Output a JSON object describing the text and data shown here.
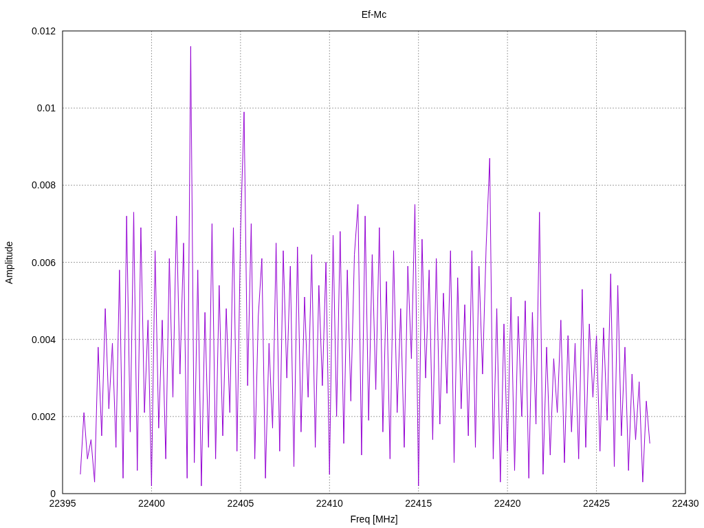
{
  "plot": {
    "chart_data": {
      "type": "line",
      "grid": true,
      "title": "Ef-Mc",
      "xlabel": "Freq [MHz]",
      "ylabel": "Amplitude",
      "xlim": [
        22395,
        22430
      ],
      "ylim": [
        0,
        0.012
      ],
      "xticks": [
        22395,
        22400,
        22405,
        22410,
        22415,
        22420,
        22425,
        22430
      ],
      "yticks": [
        0.012,
        0.01,
        0.008,
        0.006,
        0.004,
        0.002,
        0
      ],
      "x": [
        22396,
        22396.2,
        22396.4,
        22396.6,
        22396.8,
        22397,
        22397.2,
        22397.4,
        22397.6,
        22397.8,
        22398,
        22398.2,
        22398.4,
        22398.6,
        22398.8,
        22399,
        22399.2,
        22399.4,
        22399.6,
        22399.8,
        22400,
        22400.2,
        22400.4,
        22400.6,
        22400.8,
        22401,
        22401.2,
        22401.4,
        22401.6,
        22401.8,
        22402,
        22402.2,
        22402.4,
        22402.6,
        22402.8,
        22403,
        22403.2,
        22403.4,
        22403.6,
        22403.8,
        22404,
        22404.2,
        22404.4,
        22404.6,
        22404.8,
        22405,
        22405.2,
        22405.4,
        22405.6,
        22405.8,
        22406,
        22406.2,
        22406.4,
        22406.6,
        22406.8,
        22407,
        22407.2,
        22407.4,
        22407.6,
        22407.8,
        22408,
        22408.2,
        22408.4,
        22408.6,
        22408.8,
        22409,
        22409.2,
        22409.4,
        22409.6,
        22409.8,
        22410,
        22410.2,
        22410.4,
        22410.6,
        22410.8,
        22411,
        22411.2,
        22411.4,
        22411.6,
        22411.8,
        22412,
        22412.2,
        22412.4,
        22412.6,
        22412.8,
        22413,
        22413.2,
        22413.4,
        22413.6,
        22413.8,
        22414,
        22414.2,
        22414.4,
        22414.6,
        22414.8,
        22415,
        22415.2,
        22415.4,
        22415.6,
        22415.8,
        22416,
        22416.2,
        22416.4,
        22416.6,
        22416.8,
        22417,
        22417.2,
        22417.4,
        22417.6,
        22417.8,
        22418,
        22418.2,
        22418.4,
        22418.6,
        22418.8,
        22419,
        22419.2,
        22419.4,
        22419.6,
        22419.8,
        22420,
        22420.2,
        22420.4,
        22420.6,
        22420.8,
        22421,
        22421.2,
        22421.4,
        22421.6,
        22421.8,
        22422,
        22422.2,
        22422.4,
        22422.6,
        22422.8,
        22423,
        22423.2,
        22423.4,
        22423.6,
        22423.8,
        22424,
        22424.2,
        22424.4,
        22424.6,
        22424.8,
        22425,
        22425.2,
        22425.4,
        22425.6,
        22425.8,
        22426,
        22426.2,
        22426.4,
        22426.6,
        22426.8,
        22427,
        22427.2,
        22427.4,
        22427.6,
        22427.8,
        22428
      ],
      "series": [
        {
          "color": "#9400d3",
          "values": [
            0.0005,
            0.0021,
            0.0009,
            0.0014,
            0.0003,
            0.0038,
            0.0015,
            0.0048,
            0.0022,
            0.0039,
            0.0012,
            0.0058,
            0.0004,
            0.0072,
            0.0016,
            0.0073,
            0.0006,
            0.0069,
            0.0021,
            0.0045,
            0.0002,
            0.0063,
            0.0017,
            0.0045,
            0.0009,
            0.0061,
            0.0025,
            0.0072,
            0.0031,
            0.0065,
            0.0004,
            0.0116,
            0.0008,
            0.0058,
            0.0002,
            0.0047,
            0.0012,
            0.007,
            0.0009,
            0.0054,
            0.0015,
            0.0048,
            0.0021,
            0.0069,
            0.0011,
            0.0068,
            0.0099,
            0.0028,
            0.007,
            0.0009,
            0.0046,
            0.0061,
            0.0004,
            0.0039,
            0.0017,
            0.0065,
            0.0011,
            0.0063,
            0.003,
            0.0059,
            0.0007,
            0.0064,
            0.0016,
            0.0051,
            0.0025,
            0.0062,
            0.0012,
            0.0054,
            0.0028,
            0.006,
            0.0005,
            0.0067,
            0.002,
            0.0068,
            0.0013,
            0.0058,
            0.0024,
            0.0062,
            0.0075,
            0.001,
            0.0072,
            0.0019,
            0.0062,
            0.0027,
            0.0069,
            0.0016,
            0.0055,
            0.0009,
            0.0063,
            0.0021,
            0.0048,
            0.0012,
            0.0059,
            0.0035,
            0.0075,
            0.0002,
            0.0066,
            0.003,
            0.0058,
            0.0014,
            0.0061,
            0.0018,
            0.0052,
            0.0026,
            0.0063,
            0.0008,
            0.0056,
            0.0022,
            0.0049,
            0.0015,
            0.0063,
            0.0012,
            0.0059,
            0.0031,
            0.0064,
            0.0087,
            0.0009,
            0.0048,
            0.0003,
            0.0044,
            0.0011,
            0.0051,
            0.0006,
            0.0046,
            0.002,
            0.005,
            0.0004,
            0.0047,
            0.0018,
            0.0073,
            0.0005,
            0.0038,
            0.001,
            0.0035,
            0.0021,
            0.0045,
            0.0008,
            0.0041,
            0.0016,
            0.0039,
            0.0009,
            0.0053,
            0.0012,
            0.0044,
            0.0025,
            0.0041,
            0.0011,
            0.0043,
            0.0019,
            0.0057,
            0.0007,
            0.0054,
            0.0015,
            0.0038,
            0.0006,
            0.0031,
            0.0014,
            0.0029,
            0.0003,
            0.0024,
            0.0013
          ]
        }
      ]
    }
  }
}
